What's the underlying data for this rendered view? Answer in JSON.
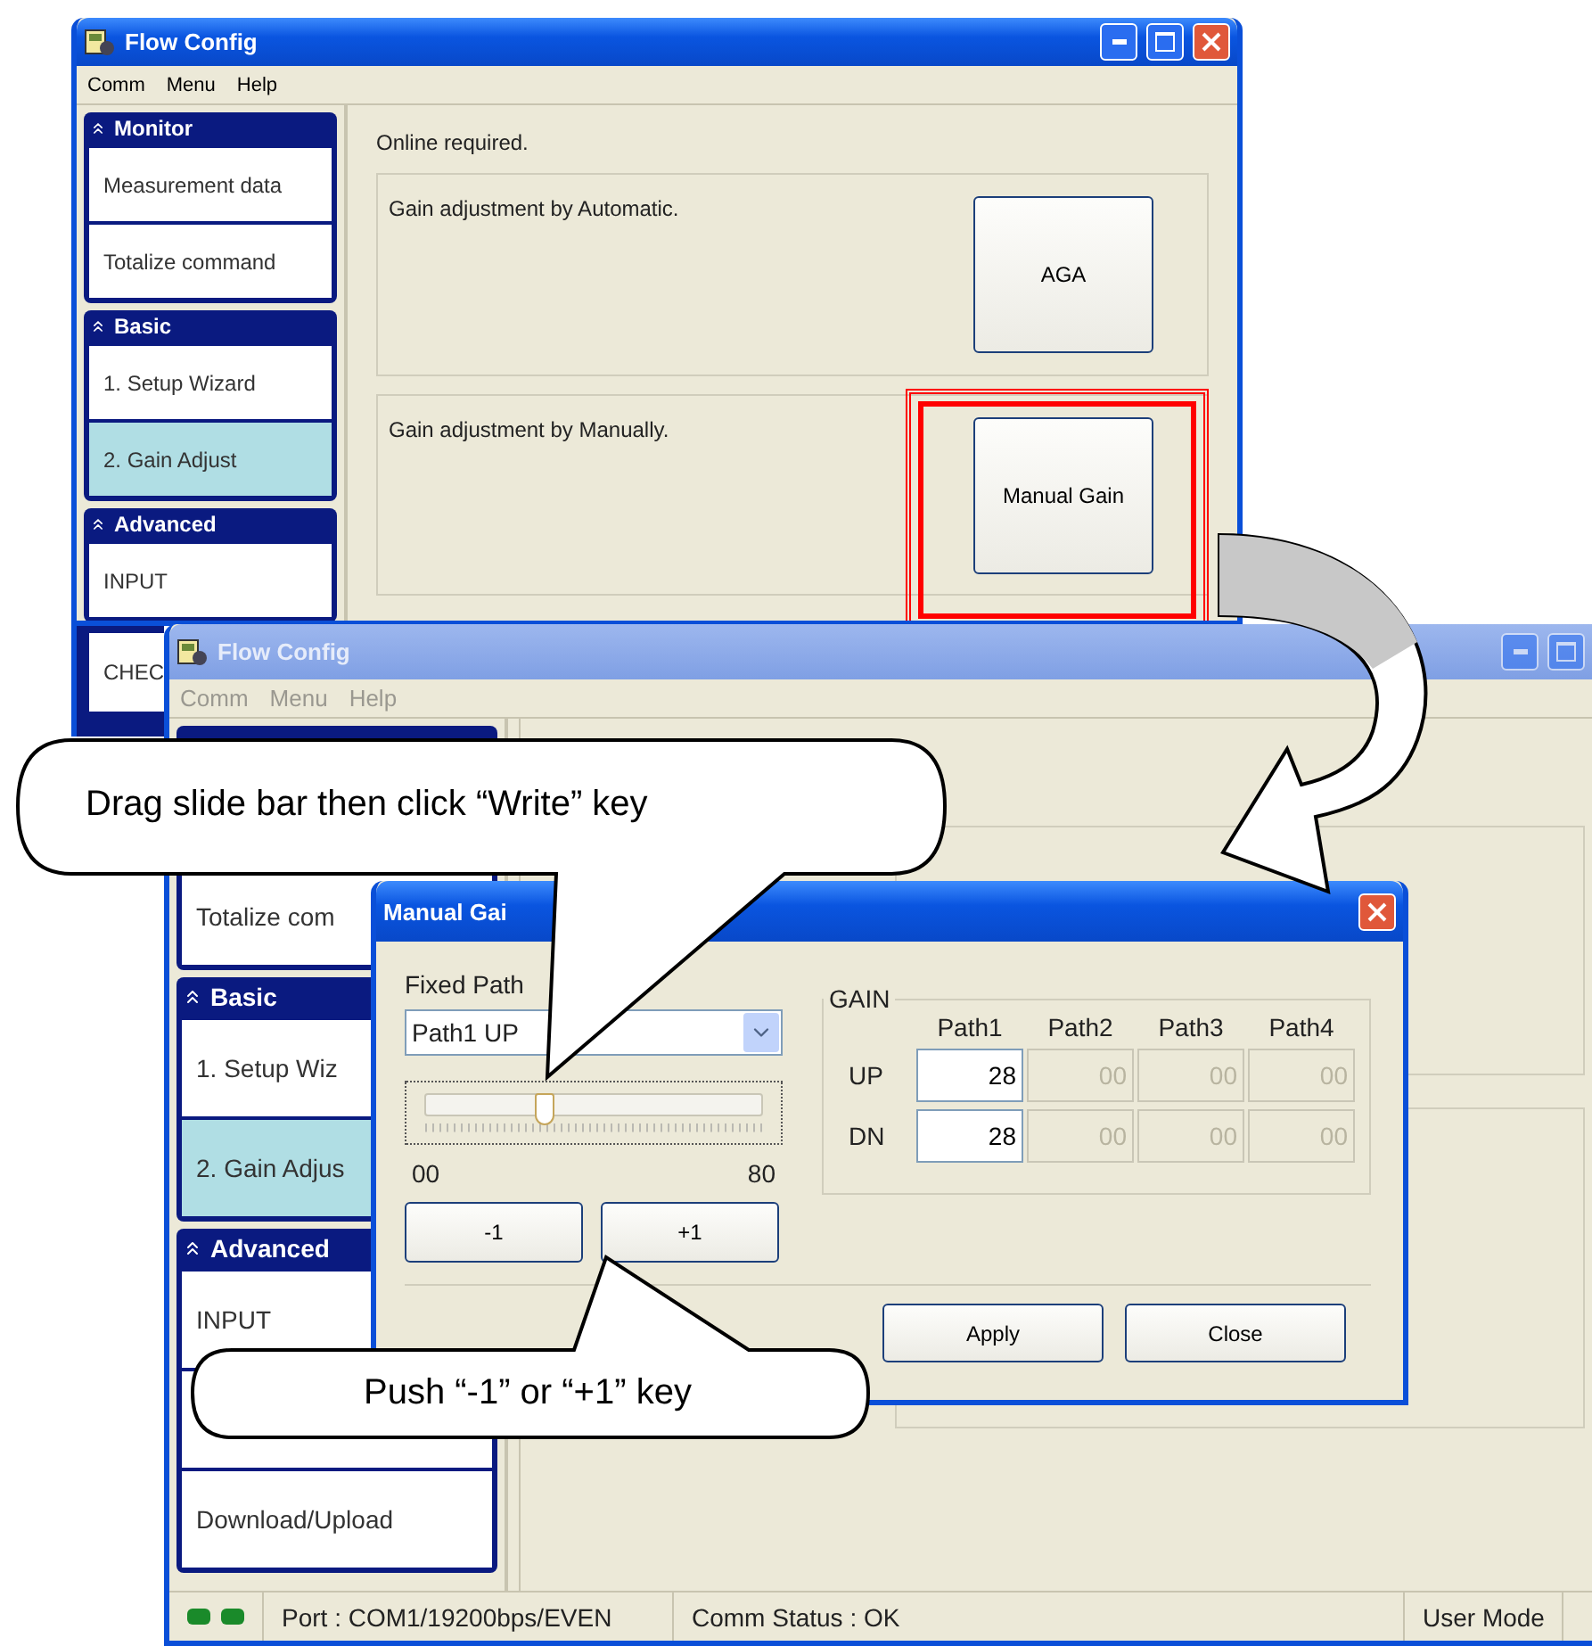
{
  "back_window": {
    "title": "Flow Config",
    "menu": [
      "Comm",
      "Menu",
      "Help"
    ],
    "sidebar": [
      {
        "title": "Monitor",
        "items": [
          {
            "label": "Measurement data",
            "selected": false
          },
          {
            "label": "Totalize command",
            "selected": false
          }
        ]
      },
      {
        "title": "Basic",
        "items": [
          {
            "label": "1. Setup Wizard",
            "selected": false
          },
          {
            "label": "2. Gain Adjust",
            "selected": true
          }
        ]
      },
      {
        "title": "Advanced",
        "items": [
          {
            "label": "INPUT",
            "selected": false
          },
          {
            "label": "CHEC",
            "selected": false
          }
        ]
      }
    ],
    "notice": "Online required.",
    "groups": [
      {
        "label": "Gain adjustment by Automatic.",
        "button": "AGA",
        "highlighted": false
      },
      {
        "label": "Gain adjustment by Manually.",
        "button": "Manual Gain",
        "highlighted": true
      }
    ]
  },
  "front_window": {
    "title": "Flow Config",
    "menu": [
      "Comm",
      "Menu",
      "Help"
    ],
    "sidebar": [
      {
        "items": [
          {
            "label": "Totalize com",
            "selected": false
          }
        ]
      },
      {
        "title": "Basic",
        "items": [
          {
            "label": "1. Setup Wiz",
            "selected": false
          },
          {
            "label": "2. Gain Adjus",
            "selected": true
          }
        ]
      },
      {
        "title": "Advanced",
        "items": [
          {
            "label": "INPUT",
            "selected": false
          },
          {
            "selected": false
          },
          {
            "label": "Download/Upload",
            "selected": false
          }
        ]
      }
    ],
    "status_bar": {
      "port": "Port : COM1/19200bps/EVEN",
      "comm_status": "Comm Status :  OK",
      "mode": "User Mode"
    }
  },
  "dialog": {
    "title": "Manual Gai",
    "fixed_path_label": "Fixed Path",
    "path_select": "Path1 UP",
    "slider": {
      "level": 0.35,
      "min_label": "00",
      "max_label": "80"
    },
    "step_buttons": [
      "-1",
      "+1"
    ],
    "gain": {
      "title": "GAIN",
      "columns": [
        "Path1",
        "Path2",
        "Path3",
        "Path4"
      ],
      "rows": [
        {
          "label": "UP",
          "values": [
            {
              "value": "28",
              "disabled": false
            },
            {
              "value": "00",
              "disabled": true
            },
            {
              "value": "00",
              "disabled": true
            },
            {
              "value": "00",
              "disabled": true
            }
          ]
        },
        {
          "label": "DN",
          "values": [
            {
              "value": "28",
              "disabled": false
            },
            {
              "value": "00",
              "disabled": true
            },
            {
              "value": "00",
              "disabled": true
            },
            {
              "value": "00",
              "disabled": true
            }
          ]
        }
      ]
    },
    "buttons": [
      "Apply",
      "Close"
    ]
  },
  "callouts": [
    {
      "text": "Drag slide bar then click “Write” key"
    },
    {
      "text": "Push “-1” or “+1” key"
    }
  ]
}
